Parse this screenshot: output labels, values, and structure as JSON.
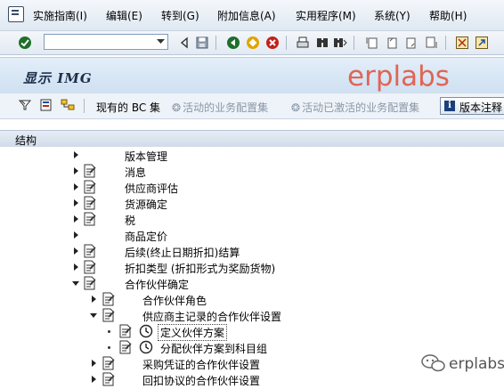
{
  "menu": {
    "items": [
      {
        "label": "实施指南(I)"
      },
      {
        "label": "编辑(E)"
      },
      {
        "label": "转到(G)"
      },
      {
        "label": "附加信息(A)"
      },
      {
        "label": "实用程序(M)"
      },
      {
        "label": "系统(Y)"
      },
      {
        "label": "帮助(H)"
      }
    ]
  },
  "command_field": {
    "value": ""
  },
  "title": "显示 IMG",
  "watermark": "erplabs",
  "app_toolbar": {
    "current_bc_set": "现有的 BC 集",
    "active_bc_set": "活动的业务配置集",
    "activated_bc_set": "活动已激活的业务配置集",
    "version_notes": "版本注释"
  },
  "structure_header": "结构",
  "tree": [
    {
      "label": "版本管理",
      "level": 0,
      "expanded": false,
      "icon": "none"
    },
    {
      "label": "消息",
      "level": 0,
      "expanded": false,
      "icon": "doc"
    },
    {
      "label": "供应商评估",
      "level": 0,
      "expanded": false,
      "icon": "doc"
    },
    {
      "label": "货源确定",
      "level": 0,
      "expanded": false,
      "icon": "doc"
    },
    {
      "label": "税",
      "level": 0,
      "expanded": false,
      "icon": "doc"
    },
    {
      "label": "商品定价",
      "level": 0,
      "expanded": false,
      "icon": "none"
    },
    {
      "label": "后续(终止日期折扣)结算",
      "level": 0,
      "expanded": false,
      "icon": "doc"
    },
    {
      "label": "折扣类型 (折扣形式为奖励货物)",
      "level": 0,
      "expanded": false,
      "icon": "doc"
    },
    {
      "label": "合作伙伴确定",
      "level": 0,
      "expanded": true,
      "icon": "doc"
    },
    {
      "label": "合作伙伴角色",
      "level": 1,
      "expanded": false,
      "icon": "doc"
    },
    {
      "label": "供应商主记录的合作伙伴设置",
      "level": 1,
      "expanded": true,
      "icon": "doc"
    },
    {
      "label": "定义伙伴方案",
      "level": 2,
      "leaf": true,
      "icon": "doc-clock",
      "selected": true
    },
    {
      "label": "分配伙伴方案到科目组",
      "level": 2,
      "leaf": true,
      "icon": "doc-clock"
    },
    {
      "label": "采购凭证的合作伙伴设置",
      "level": 1,
      "expanded": false,
      "icon": "doc"
    },
    {
      "label": "回扣协议的合作伙伴设置",
      "level": 1,
      "expanded": false,
      "icon": "doc"
    }
  ],
  "footer_watermark": "erplabs"
}
